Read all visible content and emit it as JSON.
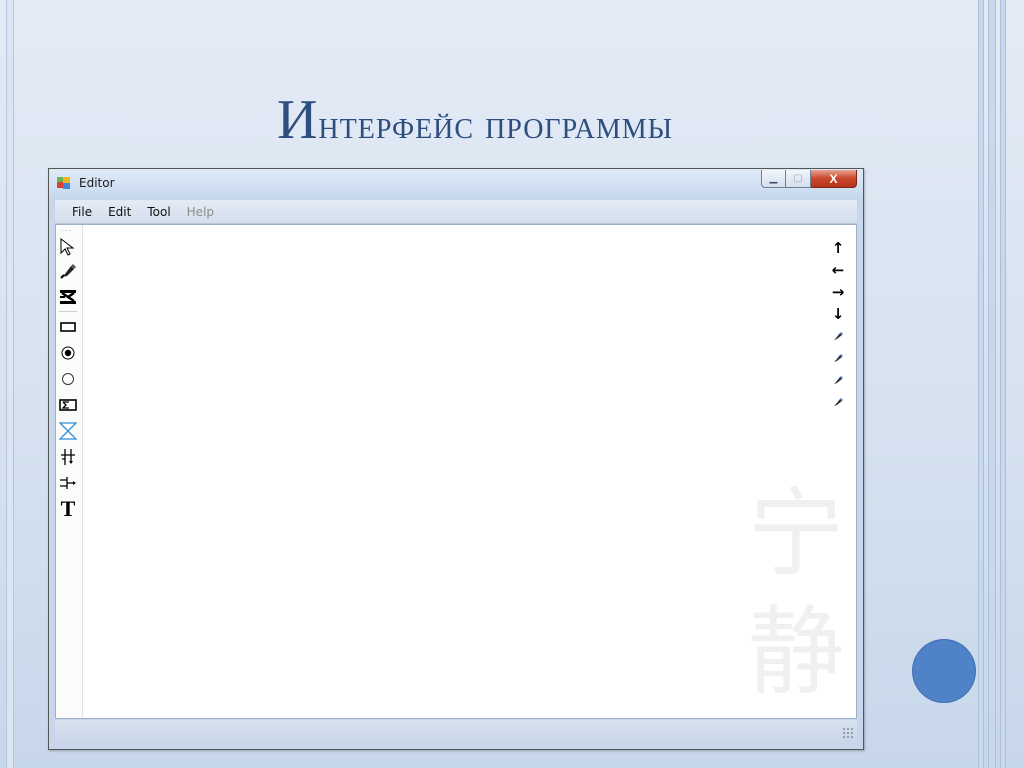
{
  "slide": {
    "title_first_letter": "И",
    "title_rest": "нтерфейс программы"
  },
  "window": {
    "title": "Editor",
    "controls": {
      "minimize_glyph": "▁",
      "maximize_glyph": "▢",
      "close_glyph": "X"
    },
    "menu": [
      {
        "label": "File",
        "enabled": true
      },
      {
        "label": "Edit",
        "enabled": true
      },
      {
        "label": "Tool",
        "enabled": true
      },
      {
        "label": "Help",
        "enabled": false
      }
    ],
    "left_toolbar": {
      "tools": [
        {
          "icon": "pointer-arrow-icon"
        },
        {
          "icon": "pen-tool-icon"
        },
        {
          "icon": "gate-symbol-icon"
        },
        {
          "icon": "rectangle-icon"
        },
        {
          "icon": "filled-circle-icon"
        },
        {
          "icon": "empty-circle-icon"
        },
        {
          "icon": "sum-block-icon"
        },
        {
          "icon": "hourglass-icon"
        },
        {
          "icon": "branch-down-icon"
        },
        {
          "icon": "branch-right-icon"
        },
        {
          "icon": "text-tool-icon",
          "label": "T"
        }
      ]
    },
    "right_toolbar": {
      "tools": [
        {
          "icon": "arrow-up-icon",
          "glyph": "↑"
        },
        {
          "icon": "arrow-left-icon",
          "glyph": "←"
        },
        {
          "icon": "arrow-right-icon",
          "glyph": "→"
        },
        {
          "icon": "arrow-down-icon",
          "glyph": "↓"
        },
        {
          "icon": "pen-small-icon"
        },
        {
          "icon": "pen-small-icon"
        },
        {
          "icon": "pen-small-icon"
        },
        {
          "icon": "pen-small-icon"
        }
      ]
    },
    "watermark_chars": [
      "宁",
      "静"
    ]
  },
  "colors": {
    "title": "#2d4e7e",
    "accent_circle": "#4f82c7",
    "close_button": "#c9472b"
  }
}
